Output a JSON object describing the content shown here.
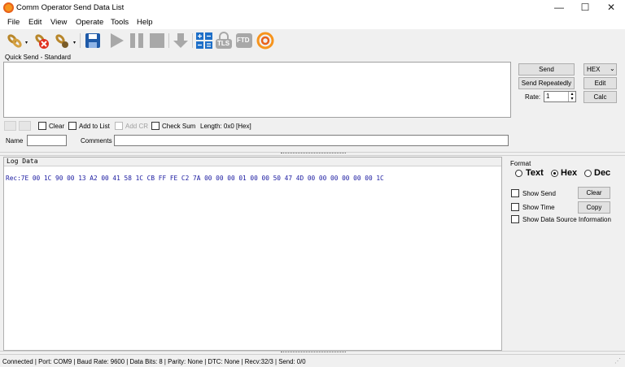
{
  "window": {
    "app_title": "Comm Operator",
    "subtitle": "Send Data List",
    "minimize": "—",
    "maximize": "☐",
    "close": "✕"
  },
  "menu": [
    "File",
    "Edit",
    "View",
    "Operate",
    "Tools",
    "Help"
  ],
  "toolbar": {
    "icons": [
      "connect-icon",
      "disconnect-icon",
      "settings-icon",
      "save-icon",
      "play-icon",
      "pause-icon",
      "stop-icon",
      "download-icon",
      "calculator-icon",
      "tls-icon",
      "ftd-icon",
      "comm-operator-icon"
    ],
    "tls_label": "TLS",
    "ftd_label": "FTD"
  },
  "quick_send": {
    "group_label": "Quick Send - Standard",
    "send_label": "Send",
    "format_select": "HEX",
    "send_repeatedly_label": "Send Repeatedly",
    "edit_label": "Edit",
    "rate_label": "Rate:",
    "rate_value": "1",
    "calc_label": "Calc",
    "clear_label": "Clear",
    "add_to_list_label": "Add to List",
    "add_cr_label": "Add CR",
    "check_sum_label": "Check Sum",
    "length_label": "Length: 0x0 [Hex]",
    "name_label": "Name",
    "comments_label": "Comments",
    "name_value": "",
    "comments_value": ""
  },
  "log": {
    "title": "Log Data",
    "line": "Rec:7E 00 1C 90 00 13 A2 00 41 58 1C CB FF FE C2 7A 00 00 00 01 00 00 50 47 4D 00 00 00 00 00 00 1C",
    "text_color": "#1a1aa0"
  },
  "format_panel": {
    "title": "Format",
    "options": [
      "Text",
      "Hex",
      "Dec"
    ],
    "selected": "Hex",
    "show_send_label": "Show Send",
    "show_time_label": "Show Time",
    "show_source_label": "Show Data Source Information",
    "clear_label": "Clear",
    "copy_label": "Copy"
  },
  "status": {
    "text": "Connected | Port: COM9 | Baud Rate: 9600 | Data Bits: 8 | Parity: None | DTC: None | Recv:32/3 | Send: 0/0"
  }
}
